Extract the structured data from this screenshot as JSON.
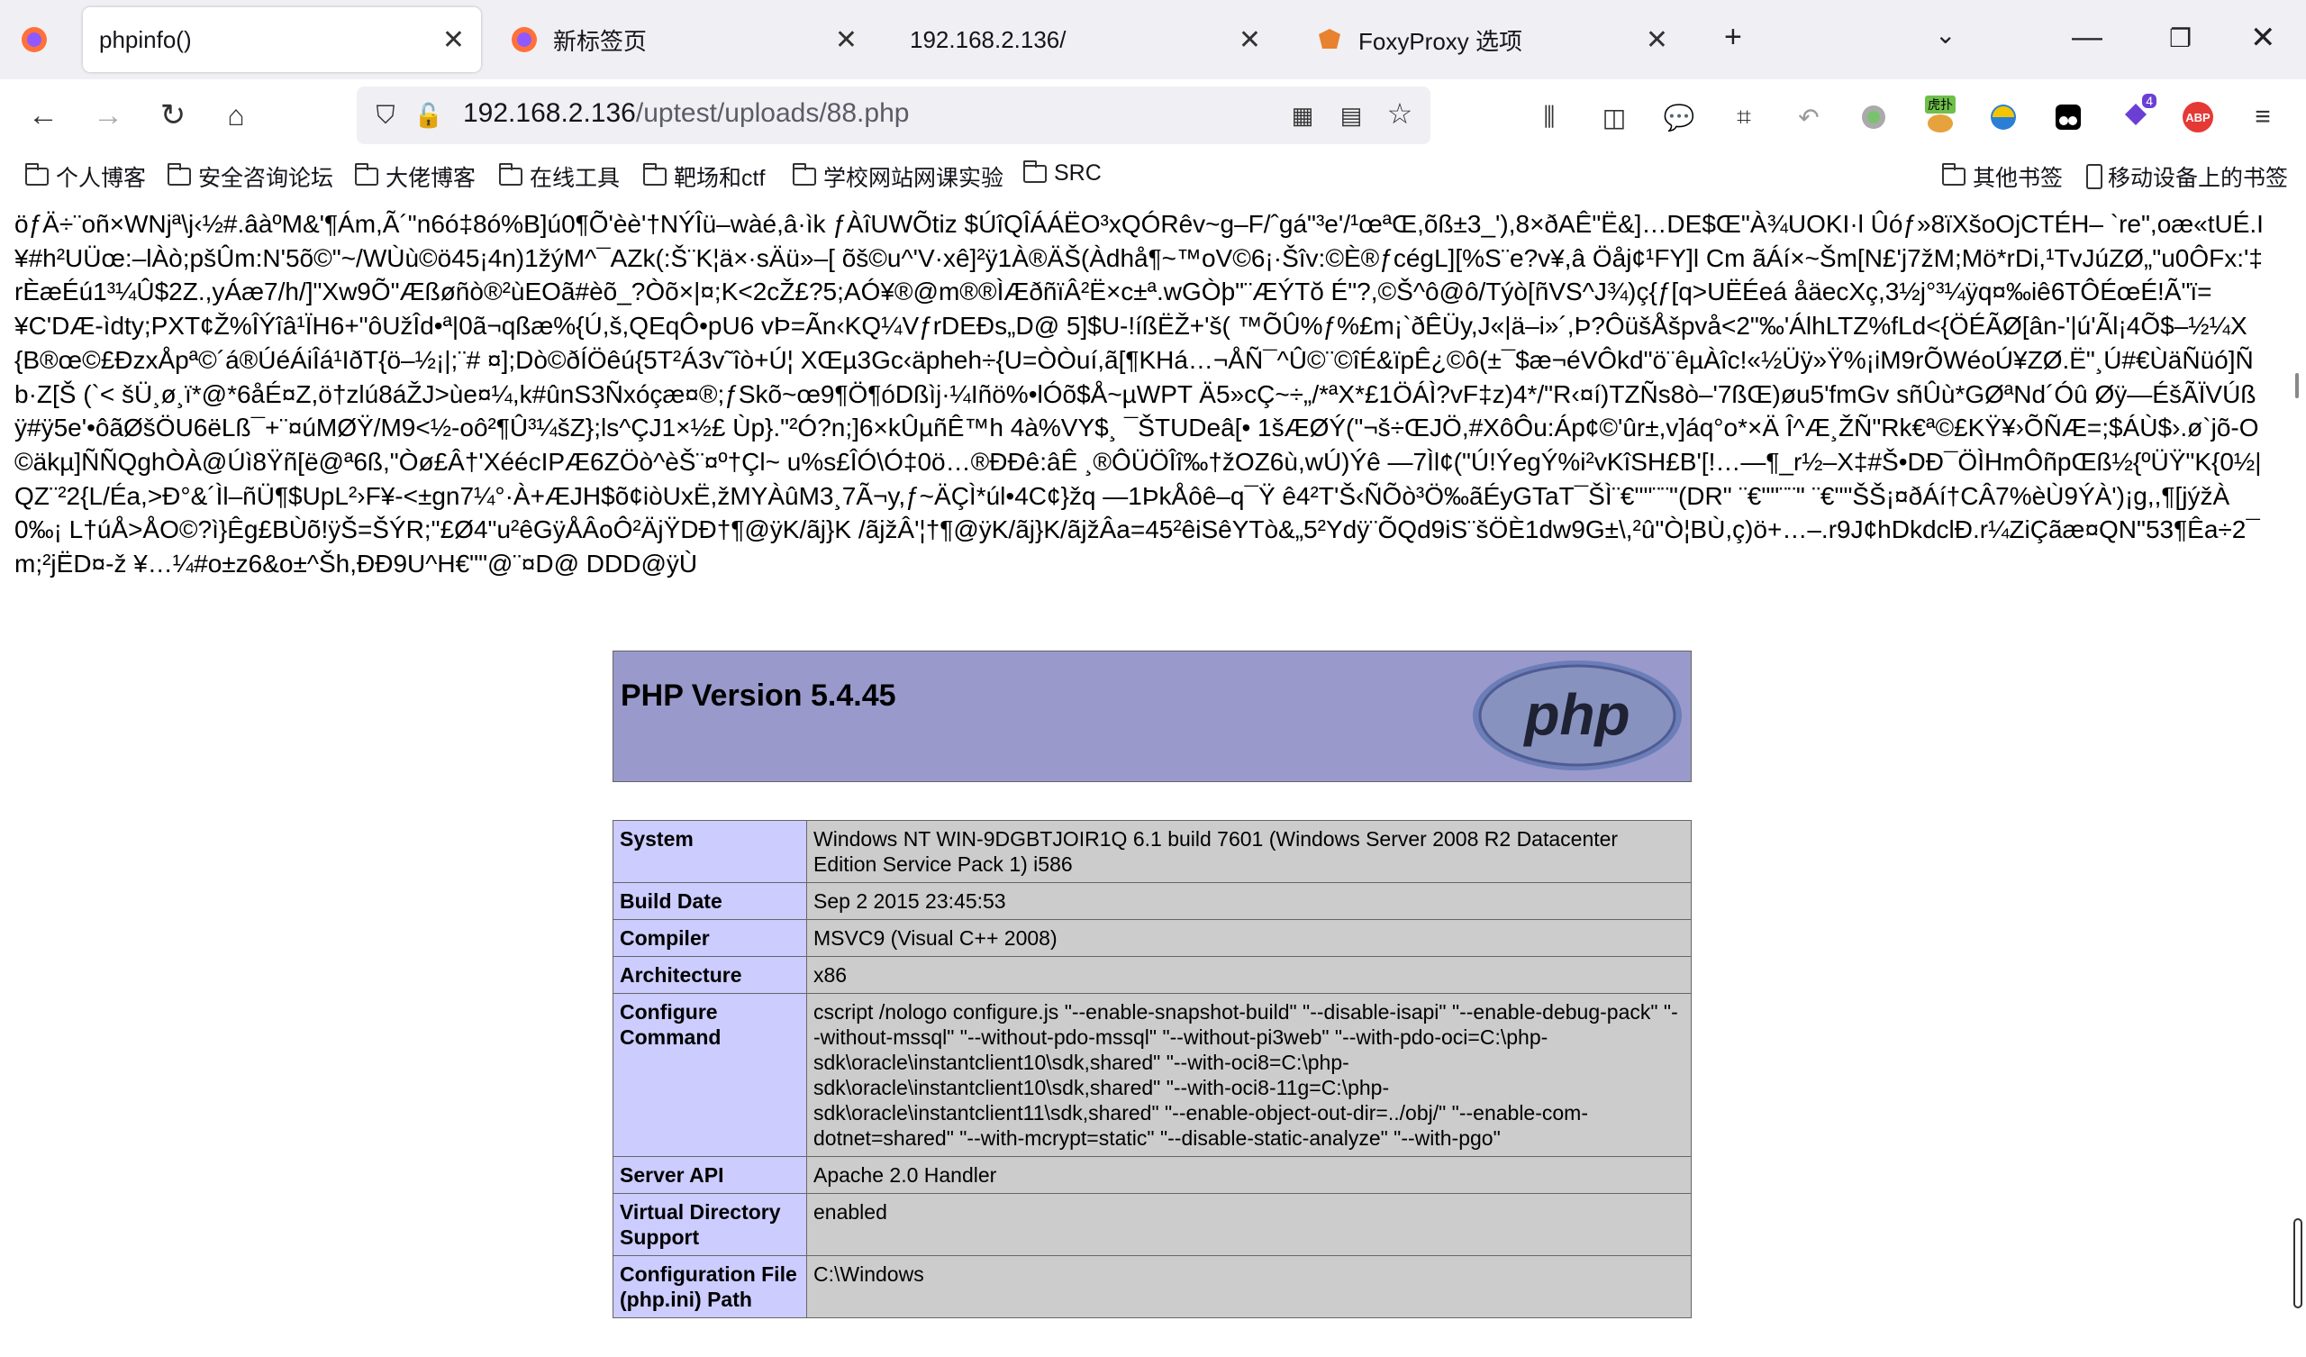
{
  "tabs": [
    {
      "label": "phpinfo()"
    },
    {
      "label": "新标签页"
    },
    {
      "label": "192.168.2.136/"
    },
    {
      "label": "FoxyProxy 选项"
    }
  ],
  "url": {
    "host": "192.168.2.136",
    "path": "/uptest/uploads/88.php"
  },
  "bookmarks": [
    "个人博客",
    "安全咨询论坛",
    "大佬博客",
    "在线工具",
    "靶场和ctf",
    "学校网站网课实验",
    "SRC"
  ],
  "bookmarks_right": [
    "其他书签",
    "移动设备上的书签"
  ],
  "extensions": {
    "badge_label": "虎扑",
    "notif_count": "4",
    "abp_label": "ABP"
  },
  "garbage_text": "öƒÄ÷¨oñ×WNjª\\j‹½#.âàºM&'¶Ám,Ã´\"n6ó‡8ó%B]ú0¶Õ'èè'†NÝÎü–wàé,â·ìk ƒÀîUWÕtiz $ÚîQÎÁÁËO³xQÓRêv~g–F/ˆgá\"³e'/¹œªŒ,õß±3_'),8×ðAÊ\"Ë&]…DE$Œ\"À¾UOKI·l Ûóƒ»8ïXšoOjCTÉH– `re\",oæ«tUÉ.I¥#h²UÜœ:–lÀò;pšÛm:N'5õ©\"~/WÙù©ö45¡4n)1žýM^¯AZk(:Š¨K¦ä×·sÄü»–[ õš©u^'V·xê]²ÿ1À®ÄŠ(Àdhå¶~™oV©6¡·Šîv:©È®ƒcégL][%S¨e?v¥,â Öåj¢¹FY]l Cm ãÁí×~Šm[N£'j7žM;Mö*rDi,¹TvJúZØ„\"u0ÔFx:'‡rÈæÉú1³¼Û$2Z.,yÁæ7/h/]\"Xw9Õ\"Æßøñò®²ùEOã#èõ_?Òõ×|¤;K<2cŽ£?5;AÓ¥®@m®®ÌÆðñïÂ²Ë×c±ª.wGÒþ\"¨ÆÝTŏ É\"?,©Š^ô@ô/Týò[ñVS^J¾)ç{ƒ[q>UËÉeá åäecXç,3½j°³¼ÿq¤‰iê6TÔÉœÉ!Ã\"ï=¥C'DÆ-ìdty;PXT¢Ž%ÎÝîâ¹ÏH6+\"ôUžÎd•ª|0ã¬qßæ%{Ú,š,QEqÔ•pU6 vÞ=Ãn‹KQ¼VƒrDEÐs„D@ 5]$U-!íßËŽ+'š( ™ÕÛ%ƒ%£m¡`ðÊÜy,J«|ä–i»´,Þ?ÔüšÅšpvå<2\"‰'ÁlhLTZ%fLd<{ÖÉÃØ[ân-'|ú'Ãl¡4Õ$–½¼X{B®œ©£ÐzxÅpª©´á®ÚéÁiÎá¹IðT{ö–½¡|;¨# ¤];Dò©ðÍÖêú{5T²Á3v˜îò+Ú¦ XŒµ3Gc‹äpheh÷{U=ÒÒuí,ã[¶KHá…¬ÅÑ¯^Û©¨©îÉ&ïpÊ¿©ô(±¯$æ¬éVÔkd\"ö¨êµÀîc!«½Üÿ»Ÿ%¡iM9rÕWéoÚ¥ZØ.Ë\"¸Ú#€ÙäÑüó]Ñb·Z[Š (`< šÜ¸ø¸ï*@*6åÉ¤Z,ö†zlú8áŽJ>ùe¤¼,k#ûnS3Ñxóçæ¤®;ƒSkõ~œ9¶Ö¶óDßìj·¼Iñö%•lÓõ$Å~µWPT Ä5»cÇ~÷„/*ªX*£1ÖÁÌ?vF‡z)4*/\"R‹¤í)TZÑs8ò–'7ßŒ)øu5'fmGv sñÛù*GØªNd´Óû Øÿ—ÉšÃÏVÚßÿ#ÿ5e'•ôãØšÖU6ëLß¯+¨¤úMØŸ/M9<½-oô²¶Û³¼šZ};ls^ÇJ1×½£ Ùp}.\"²Ó?n;]6×kÛµñÊ™h 4à%VY$¸ ¯ŠTUDeâ[• 1šÆØÝ(\"¬š÷ŒJÖ,#XôÔu:Áp¢©'ûr±,v]áq°o*×Ä Î^Æ¸ŽÑ\"Rk€ª©£KŸ¥›ÕÑÆ=;$ÁÙ$›.ø`jõ-O©äkµ]ÑÑQghÒÀ@Úì8Ÿñ[ë@ª6ß,\"Òø£Â†'XéécIPÆ6ZÖò^èŠ¨¤º†Çl~ u%s£ÎÓ\\Ó‡0ö…®ÐÐê:âÊ ¸®ÔÜÖÎî‰†žOZ6ù,wÚ)Ýê —7Ìl¢(\"Ú!ÝegÝ%i²vKîSH£B'[!…—¶_r½–X‡#Š•DÐ¯ÖÌHmÔñpŒß½{ºÜŸ\"K{0½|QZ¨²2{L/Éa,>Ð°&´Ìl–ñÜ¶$UpL²›F¥-<±gn7¼°·À+ÆJH$õ¢iòUxË,žMYÀûM3¸7Ã¬y,ƒ~ÄÇÌ*úl•4C¢}žq —1ÞkÅôê–q¯Ÿ ê4²T'Š‹ÑÕò³Ö‰ãÉyGTaT¯ŠÌ¨€\"\"¨¨\"(DR\" ¨€\"\"¨¨\" ¨€\"\"ŠŠ¡¤ðÁí†CÂ7%èÙ9ÝÀ')¡g,,¶[jýžÀ0‰¡ L†úÅ>ÅO©?ì}Êg£BÙõ!ÿŠ=ŠÝR;\"£Ø4\"u²êGÿÅÂoÔ²ÄjŸDÐ†¶@ÿK/ãj}K /ãjžÂ'¦†¶@ÿK/ãj}K/ãjžÂa=45²êiSêYTò&„5²Ydÿ¨ÕQd9iS¨šÖÈ1dw9G±\\,²û\"Ò¦BÙ,ç)ö+…–.r9J¢hDkdclÐ.r¼ZiÇãæ¤QN\"53¶Êa÷2¯m;²jËD¤-ž ¥…¼#o±z6&o±^Šh,ÐÐ9U^H€\"\"@¨¤D@ DDD@ÿÙ",
  "php": {
    "version": "PHP Version 5.4.45",
    "logo_text": "php"
  },
  "info_rows": [
    {
      "key": "System",
      "value": "Windows NT WIN-9DGBTJOIR1Q 6.1 build 7601 (Windows Server 2008 R2 Datacenter Edition Service Pack 1) i586"
    },
    {
      "key": "Build Date",
      "value": "Sep 2 2015 23:45:53"
    },
    {
      "key": "Compiler",
      "value": "MSVC9 (Visual C++ 2008)"
    },
    {
      "key": "Architecture",
      "value": "x86"
    },
    {
      "key": "Configure Command",
      "value": "cscript /nologo configure.js \"--enable-snapshot-build\" \"--disable-isapi\" \"--enable-debug-pack\" \"--without-mssql\" \"--without-pdo-mssql\" \"--without-pi3web\" \"--with-pdo-oci=C:\\php-sdk\\oracle\\instantclient10\\sdk,shared\" \"--with-oci8=C:\\php-sdk\\oracle\\instantclient10\\sdk,shared\" \"--with-oci8-11g=C:\\php-sdk\\oracle\\instantclient11\\sdk,shared\" \"--enable-object-out-dir=../obj/\" \"--enable-com-dotnet=shared\" \"--with-mcrypt=static\" \"--disable-static-analyze\" \"--with-pgo\""
    },
    {
      "key": "Server API",
      "value": "Apache 2.0 Handler"
    },
    {
      "key": "Virtual Directory Support",
      "value": "enabled"
    },
    {
      "key": "Configuration File (php.ini) Path",
      "value": "C:\\Windows"
    }
  ]
}
